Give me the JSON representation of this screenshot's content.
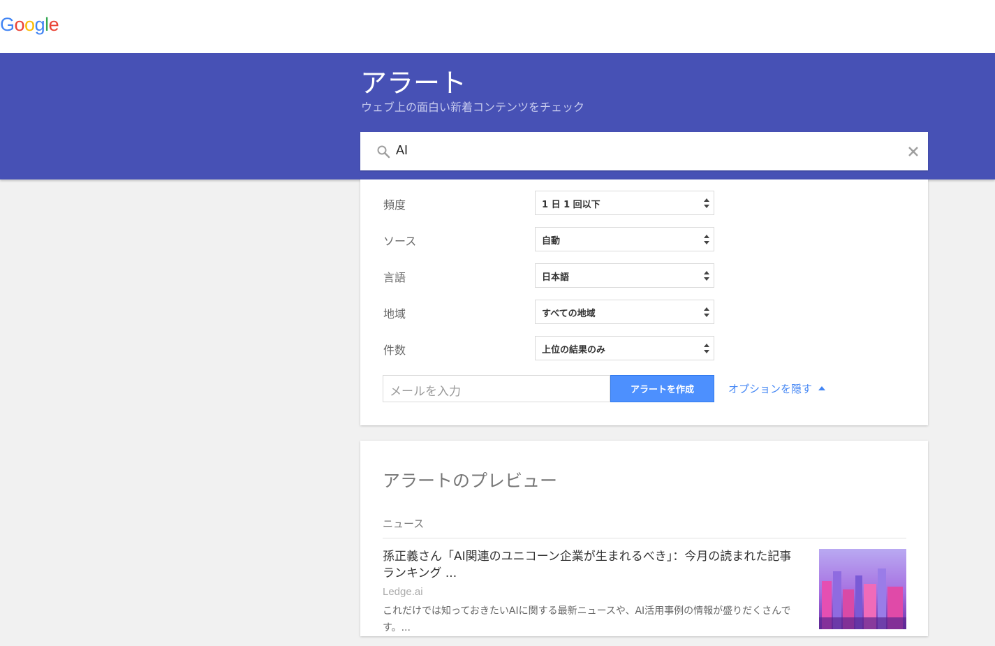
{
  "brand": {
    "logo_letters": [
      "G",
      "o",
      "o",
      "g",
      "l",
      "e"
    ]
  },
  "header": {
    "title": "アラート",
    "subtitle": "ウェブ上の面白い新着コンテンツをチェック",
    "background_color": "#4751b5"
  },
  "search": {
    "value": "AI",
    "icon": "search-icon",
    "clear_icon": "close-icon"
  },
  "options": {
    "rows": [
      {
        "label": "頻度",
        "value": "1 日 1 回以下"
      },
      {
        "label": "ソース",
        "value": "自動"
      },
      {
        "label": "言語",
        "value": "日本語"
      },
      {
        "label": "地域",
        "value": "すべての地域"
      },
      {
        "label": "件数",
        "value": "上位の結果のみ"
      }
    ],
    "email_placeholder": "メールを入力",
    "create_button": "アラートを作成",
    "hide_options_link": "オプションを隠す",
    "button_color": "#4d90fe",
    "link_color": "#4285f4"
  },
  "preview": {
    "title": "アラートのプレビュー",
    "section": "ニュース",
    "items": [
      {
        "title": "孫正義さん「AI関連のユニコーン企業が生まれるべき」：今月の読まれた記事ランキング ...",
        "source": "Ledge.ai",
        "snippet": "これだけでは知っておきたいAIに関する最新ニュースや、AI活用事例の情報が盛りだくさんです。..."
      }
    ]
  }
}
